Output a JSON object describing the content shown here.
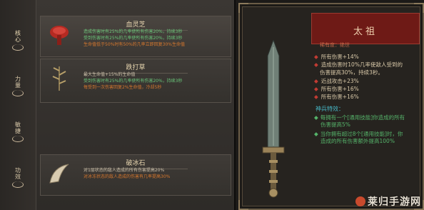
{
  "tabs": [
    {
      "label": "核心",
      "icon": "hook-mark-icon"
    },
    {
      "label": "力量",
      "icon": "hook-mark-icon"
    },
    {
      "label": "敏捷",
      "icon": "hook-mark-icon"
    },
    {
      "label": "功效",
      "icon": "hook-mark-icon"
    }
  ],
  "cards": [
    {
      "name": "血灵芝",
      "icon": "red-mushroom-icon",
      "lines": [
        {
          "text": "造成伤害时有25%的几率使所有伤害20%，持续3秒",
          "color": "green"
        },
        {
          "text": "受到伤害时有25%的几率使所有伤害20%，持续3秒",
          "color": "green"
        },
        {
          "text": "生命值低于50%时有50%的几率立即回复30%生命值",
          "color": "orange"
        }
      ]
    },
    {
      "name": "跌打草",
      "icon": "herb-sprig-icon",
      "lines": [
        {
          "text": "最大生命值+15%的生命值",
          "color": "white"
        },
        {
          "text": "受到伤害时有25%的几率使所有伤害20%，持续3秒",
          "color": "green"
        },
        {
          "text": "每受到一次伤害回复2%生命值，冷却5秒",
          "color": "orange"
        }
      ]
    },
    {
      "name": "破冰石",
      "icon": "horn-stone-icon",
      "lines": [
        {
          "text": "对1层状态的敌人造成的所有伤害提高20%",
          "color": "white"
        },
        {
          "text": "对冰冻状态的敌人造成的伤害有几率提高30%",
          "color": "orange"
        }
      ]
    }
  ],
  "weapon": {
    "name": "太祖",
    "subtitle": "稀有度：绝世",
    "stats": [
      "所有伤害+14%",
      "造成伤害时10%几率使敌人受到的",
      "伤害提高30%，持续3秒。",
      "近战攻击+23%",
      "所有伤害+16%",
      "所有伤害+16%"
    ],
    "special_header": "神兵特效：",
    "special": [
      "每拥有一个[通用技能]你造成的所有",
      "伤害提高5%",
      "当你拥有超过8个[通用技能]时，你",
      "造成的所有伤害额外提高100%"
    ]
  },
  "watermark": {
    "text": "莱归手游网"
  },
  "colors": {
    "accent_red": "#6e1a16",
    "stat_green": "#55b36a",
    "header_cyan": "#46b7c7"
  }
}
